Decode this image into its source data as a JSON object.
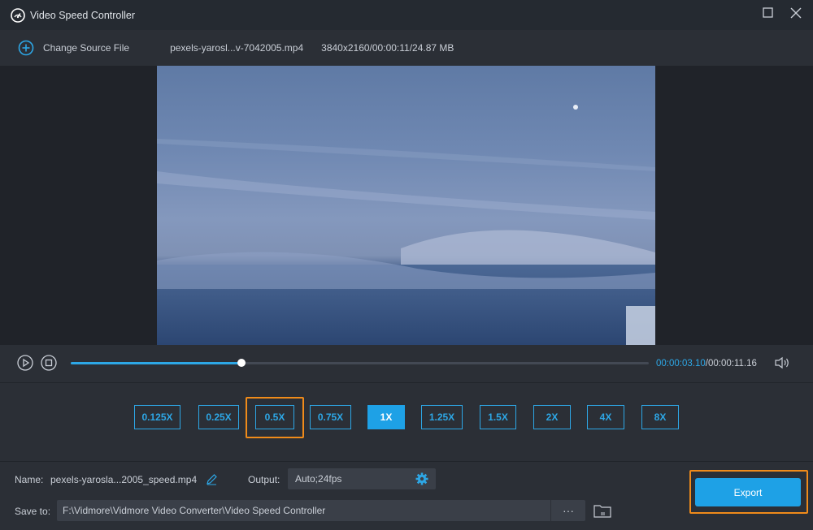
{
  "window": {
    "title": "Video Speed Controller"
  },
  "toolbar": {
    "change_source_label": "Change Source File",
    "file_name": "pexels-yarosl...v-7042005.mp4",
    "file_meta": "3840x2160/00:00:11/24.87 MB"
  },
  "player": {
    "current_time": "00:00:03.10",
    "separator": "/",
    "total_time": "00:00:11.16",
    "progress_fraction": 0.295
  },
  "speeds": [
    {
      "label": "0.125X",
      "active": false
    },
    {
      "label": "0.25X",
      "active": false
    },
    {
      "label": "0.5X",
      "active": false,
      "highlighted": true
    },
    {
      "label": "0.75X",
      "active": false
    },
    {
      "label": "1X",
      "active": true
    },
    {
      "label": "1.25X",
      "active": false
    },
    {
      "label": "1.5X",
      "active": false
    },
    {
      "label": "2X",
      "active": false
    },
    {
      "label": "4X",
      "active": false
    },
    {
      "label": "8X",
      "active": false
    }
  ],
  "output": {
    "name_label": "Name:",
    "name_value": "pexels-yarosla...2005_speed.mp4",
    "output_label": "Output:",
    "output_value": "Auto;24fps",
    "save_label": "Save to:",
    "save_path": "F:\\Vidmore\\Vidmore Video Converter\\Video Speed Controller",
    "browse_label": "···",
    "export_label": "Export"
  },
  "colors": {
    "accent": "#1ea1e6",
    "highlight": "#f08b1a",
    "background": "#2b2f36"
  },
  "icons": {
    "app": "speedometer-icon",
    "add": "plus-circle-icon",
    "play": "play-icon",
    "stop": "stop-icon",
    "volume": "speaker-icon",
    "edit": "pencil-icon",
    "settings": "gear-icon",
    "folder": "folder-icon"
  }
}
